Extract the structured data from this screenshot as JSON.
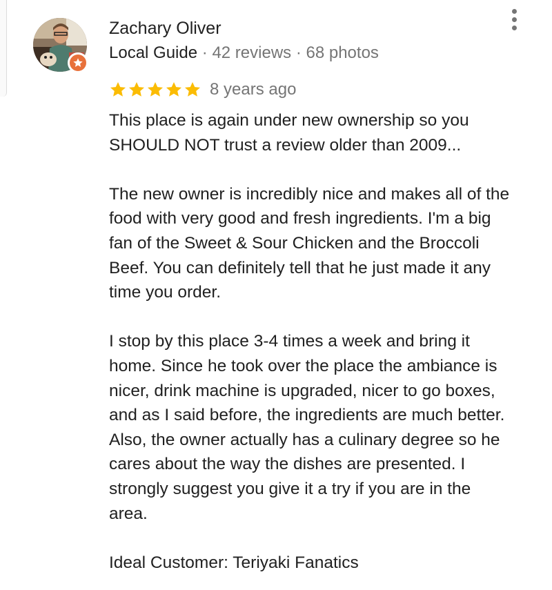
{
  "review": {
    "author": {
      "name": "Zachary Oliver",
      "badge": "Local Guide",
      "separator": "·",
      "reviews": "42 reviews",
      "photos": "68 photos",
      "avatar_icon": "profile-photo",
      "badge_icon": "local-guide-star-icon",
      "badge_color": "#e8713b"
    },
    "menu_icon": "more-vert-icon",
    "rating": 5,
    "star_color": "#fbbc04",
    "date": "8 years ago",
    "paragraphs": [
      [
        "This place is again under new ownership so you",
        "SHOULD NOT trust a review older than 2009..."
      ],
      [
        "The new owner is incredibly nice and makes all of the",
        "food with very good and fresh ingredients. I'm a big",
        "fan of the Sweet & Sour Chicken and the Broccoli",
        "Beef. You can definitely tell that he just made it any",
        "time you order."
      ],
      [
        "I stop by this place 3-4 times a week and bring it",
        "home. Since he took over the place the ambiance is",
        "nicer, drink machine is upgraded, nicer to go boxes,",
        "and as I said before, the ingredients are much better.",
        "Also, the owner actually has a culinary degree so he",
        "cares about the way the dishes are presented. I",
        "strongly suggest you give it a try if you are in the",
        "area."
      ],
      [
        "Ideal Customer: Teriyaki Fanatics"
      ]
    ]
  }
}
